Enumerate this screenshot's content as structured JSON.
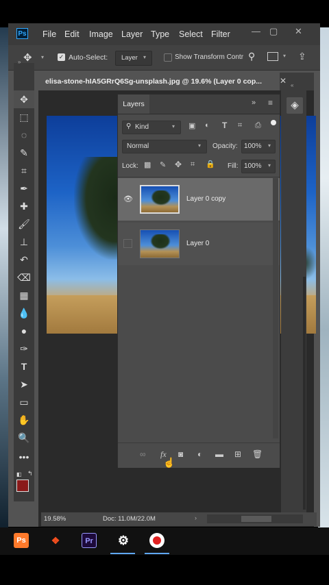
{
  "app": {
    "logo": "Ps",
    "menu": [
      "File",
      "Edit",
      "Image",
      "Layer",
      "Type",
      "Select",
      "Filter"
    ],
    "window_controls": {
      "minimize": "—",
      "maximize": "▢",
      "close": "✕"
    }
  },
  "options_bar": {
    "auto_select_label": "Auto-Select:",
    "auto_select_checked": true,
    "auto_select_target": "Layer",
    "show_transform_label": "Show Transform Contr"
  },
  "document": {
    "tab_title": "elisa-stone-hIA5GRrQ6Sg-unsplash.jpg @ 19.6% (Layer 0 cop...",
    "zoom": "19.58%",
    "doc_size": "Doc: 11.0M/22.0M"
  },
  "layers_panel": {
    "tab_label": "Layers",
    "filter_label": "Kind",
    "blend_mode": "Normal",
    "opacity_label": "Opacity:",
    "opacity_value": "100%",
    "lock_label": "Lock:",
    "fill_label": "Fill:",
    "fill_value": "100%",
    "layers": [
      {
        "name": "Layer 0 copy",
        "visible": true,
        "selected": true
      },
      {
        "name": "Layer 0",
        "visible": false,
        "selected": false
      }
    ],
    "footer_fx": "fx"
  },
  "taskbar": {
    "apps": [
      "Ps",
      "Figma",
      "Pr",
      "Settings",
      "Record"
    ]
  },
  "colors": {
    "ps_blue": "#31a8ff",
    "foreground_swatch": "#8a1a1a",
    "record_red": "#e02020"
  }
}
